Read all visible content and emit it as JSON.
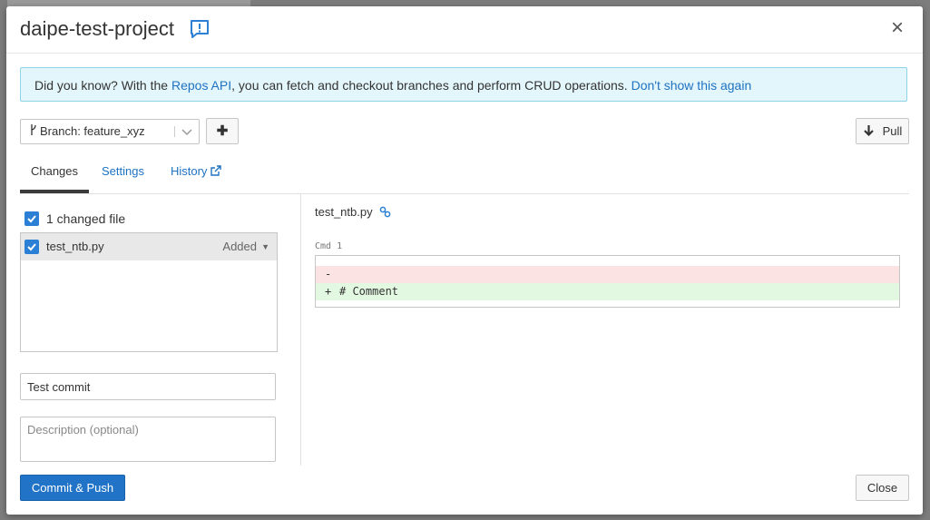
{
  "modal": {
    "title": "daipe-test-project",
    "feedback_icon": "feedback-icon",
    "close_icon": "close-icon"
  },
  "banner": {
    "prefix": "Did you know? With the ",
    "link_api": "Repos API",
    "middle": ", you can fetch and checkout branches and perform CRUD operations. ",
    "link_dismiss": "Don't show this again"
  },
  "branch": {
    "label": "Branch: feature_xyz",
    "branch_icon": "git-branch-icon",
    "plus_icon": "plus-icon"
  },
  "pull": {
    "label": "Pull",
    "icon": "arrow-down-icon"
  },
  "tabs": [
    {
      "label": "Changes",
      "active": true
    },
    {
      "label": "Settings",
      "active": false
    },
    {
      "label": "History",
      "active": false,
      "icon": "external-link-icon"
    }
  ],
  "changes": {
    "summary": "1 changed file",
    "files": [
      {
        "name": "test_ntb.py",
        "status": "Added"
      }
    ]
  },
  "commit": {
    "message": "Test commit",
    "description_placeholder": "Description (optional)"
  },
  "diff": {
    "file": "test_ntb.py",
    "cmd_label": "Cmd 1",
    "lines": [
      {
        "sign": "-",
        "text": ""
      },
      {
        "sign": "+",
        "text": "# Comment"
      }
    ]
  },
  "footer": {
    "commit_push": "Commit & Push",
    "close": "Close"
  },
  "colors": {
    "accent": "#2073c6",
    "link": "#1f72c2",
    "banner_bg": "#e3f6fb",
    "removed_bg": "#fbe3e3",
    "added_bg": "#e2f8e0"
  }
}
